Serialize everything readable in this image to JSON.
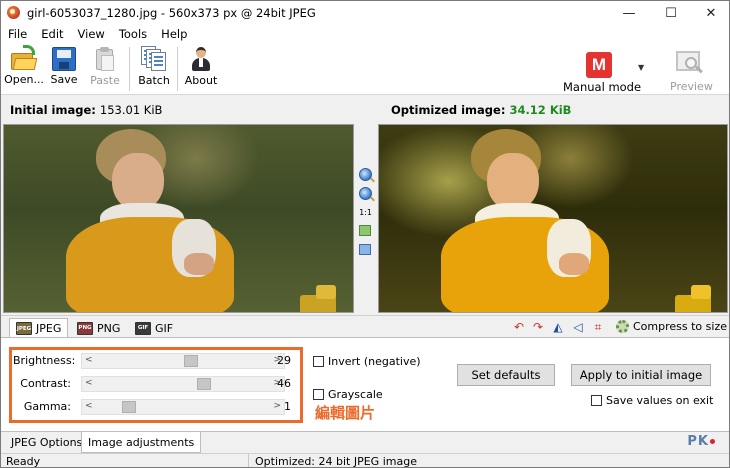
{
  "window": {
    "title": "girl-6053037_1280.jpg - 560x373 px @ 24bit JPEG",
    "controls": {
      "minimize": "—",
      "maximize": "☐",
      "close": "✕"
    }
  },
  "menu": [
    "File",
    "Edit",
    "View",
    "Tools",
    "Help"
  ],
  "toolbar": {
    "open": "Open...",
    "save": "Save",
    "paste": "Paste",
    "batch": "Batch",
    "about": "About",
    "mode_badge": "M",
    "mode_label": "Manual mode",
    "mode_arrow": "▼",
    "preview": "Preview"
  },
  "info": {
    "initial_label": "Initial image:",
    "initial_size": "153.01 KiB",
    "optimized_label": "Optimized image:",
    "optimized_size": "34.12 KiB",
    "optimized_color": "#1f8a1f"
  },
  "zoom": {
    "actual_size": "1:1"
  },
  "format_tabs": [
    {
      "label": "JPEG",
      "badge": "JPEG",
      "active": true
    },
    {
      "label": "PNG",
      "badge": "PNG",
      "active": false
    },
    {
      "label": "GIF",
      "badge": "GIF",
      "active": false
    }
  ],
  "actions": {
    "rotate_left": "↶",
    "rotate_right": "↷",
    "flip_horizontal": "◭",
    "flip_vertical": "◁",
    "crop": "⌗",
    "compress_label": "Compress to size"
  },
  "adjustments": {
    "sliders": [
      {
        "label": "Brightness:",
        "value": "29",
        "position": 0.55
      },
      {
        "label": "Contrast:",
        "value": "46",
        "position": 0.63
      },
      {
        "label": "Gamma:",
        "value": "1",
        "position": 0.17
      }
    ],
    "arrow_left": "<",
    "arrow_right": ">",
    "invert_label": "Invert (negative)",
    "grayscale_label": "Grayscale",
    "set_defaults": "Set defaults",
    "apply_initial": "Apply to initial image",
    "save_on_exit": "Save values on exit",
    "annotation": "編輯圖片",
    "highlight_color": "#ec6a2b"
  },
  "bottom_tabs": [
    {
      "label": "JPEG Options",
      "active": false
    },
    {
      "label": "Image adjustments",
      "active": true
    }
  ],
  "watermark": "PK",
  "status": {
    "left": "Ready",
    "right": "Optimized: 24 bit JPEG image"
  }
}
